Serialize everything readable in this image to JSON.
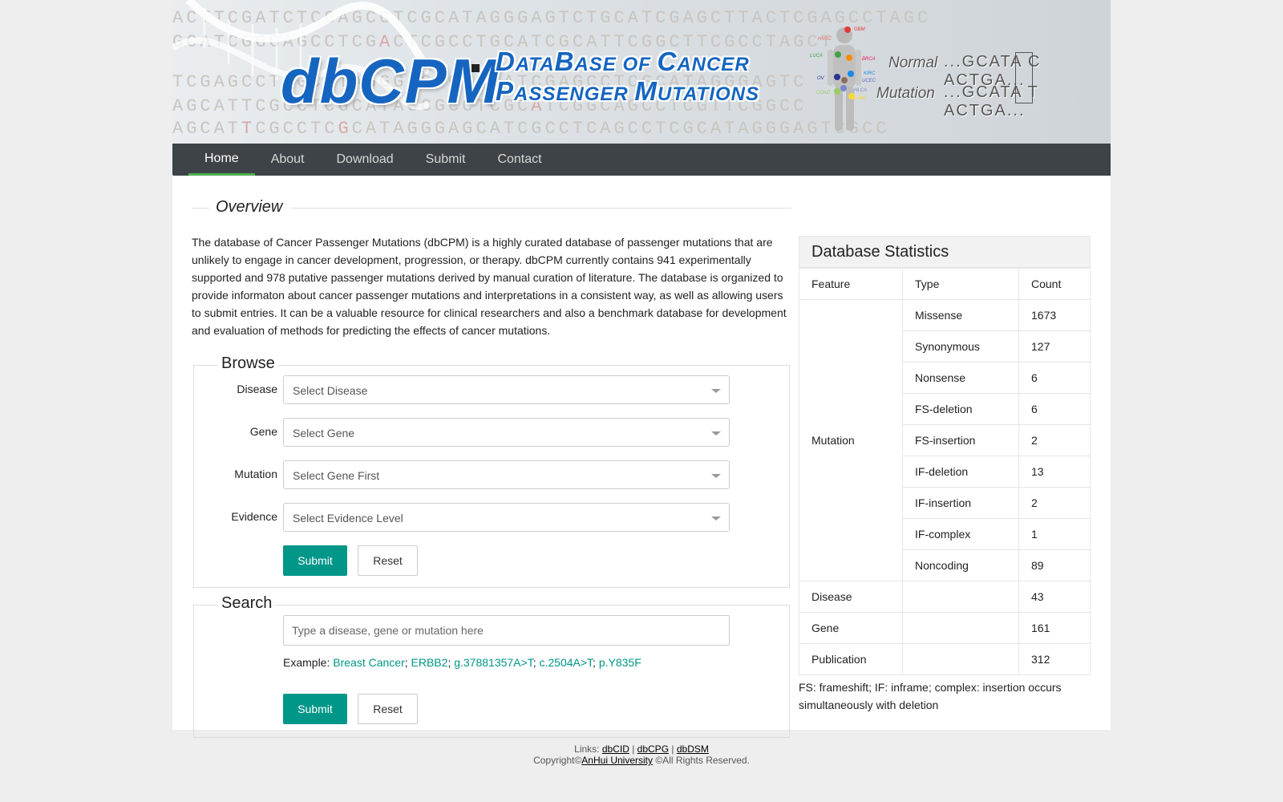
{
  "banner": {
    "logo": "dbCPM",
    "title_line1": [
      "D",
      "ATA",
      "B",
      "ASE OF ",
      "C",
      "ANCER"
    ],
    "title_line2": [
      "P",
      "ASSENGER ",
      "M",
      "UTATIONS"
    ],
    "body_labels": [
      "GBM",
      "HNSC",
      "LUCA",
      "BRCA",
      "KIRC",
      "OV",
      "UCEC",
      "COAD",
      "HLCA",
      "LAML"
    ],
    "normal_label": "Normal",
    "normal_seq": "...GCATA C ACTGA...",
    "mutation_label": "Mutation",
    "mutation_seq": "...GCATA T ACTGA...",
    "colors": {
      "logo_blue": "#1565c0"
    }
  },
  "nav": {
    "items": [
      "Home",
      "About",
      "Download",
      "Submit",
      "Contact"
    ],
    "active": "Home"
  },
  "overview": {
    "heading": "Overview",
    "text": "The database of Cancer Passenger Mutations (dbCPM) is a highly curated database of passenger mutations that are unlikely to engage in cancer development, progression, or therapy. dbCPM currently contains 941 experimentally supported and 978 putative passenger mutations derived by manual curation of literature. The database is organized to provide informaton about cancer passenger mutations and interpretations in a consistent way, as well as allowing users to submit entries. It can be a valuable resource for clinical researchers and also a benchmark database for development and evaluation of methods for predicting the effects of cancer mutations."
  },
  "browse": {
    "legend": "Browse",
    "fields": [
      {
        "label": "Disease",
        "placeholder": "Select Disease"
      },
      {
        "label": "Gene",
        "placeholder": "Select Gene"
      },
      {
        "label": "Mutation",
        "placeholder": "Select Gene First"
      },
      {
        "label": "Evidence",
        "placeholder": "Select Evidence Level"
      }
    ],
    "submit_label": "Submit",
    "reset_label": "Reset"
  },
  "search": {
    "legend": "Search",
    "placeholder": "Type a disease, gene or mutation here",
    "example_prefix": "Example:",
    "examples": [
      "Breast Cancer",
      "ERBB2",
      "g.37881357A>T",
      "c.2504A>T",
      "p.Y835F"
    ],
    "submit_label": "Submit",
    "reset_label": "Reset"
  },
  "stats": {
    "title": "Database Statistics",
    "headers": [
      "Feature",
      "Type",
      "Count"
    ],
    "mutation_label": "Mutation",
    "mutation_rows": [
      {
        "type": "Missense",
        "count": "1673"
      },
      {
        "type": "Synonymous",
        "count": "127"
      },
      {
        "type": "Nonsense",
        "count": "6"
      },
      {
        "type": "FS-deletion",
        "count": "6"
      },
      {
        "type": "FS-insertion",
        "count": "2"
      },
      {
        "type": "IF-deletion",
        "count": "13"
      },
      {
        "type": "IF-insertion",
        "count": "2"
      },
      {
        "type": "IF-complex",
        "count": "1"
      },
      {
        "type": "Noncoding",
        "count": "89"
      }
    ],
    "other_rows": [
      {
        "feature": "Disease",
        "type": "",
        "count": "43"
      },
      {
        "feature": "Gene",
        "type": "",
        "count": "161"
      },
      {
        "feature": "Publication",
        "type": "",
        "count": "312"
      }
    ],
    "note": "FS: frameshift; IF: inframe; complex: insertion occurs simultaneously with deletion"
  },
  "footer": {
    "links_prefix": "Links:",
    "links": [
      "dbCID",
      "dbCPG",
      "dbDSM"
    ],
    "separator": "|",
    "copyright_prefix": "Copyright©",
    "org": "AnHui University",
    "rights": "©All Rights Reserved."
  }
}
